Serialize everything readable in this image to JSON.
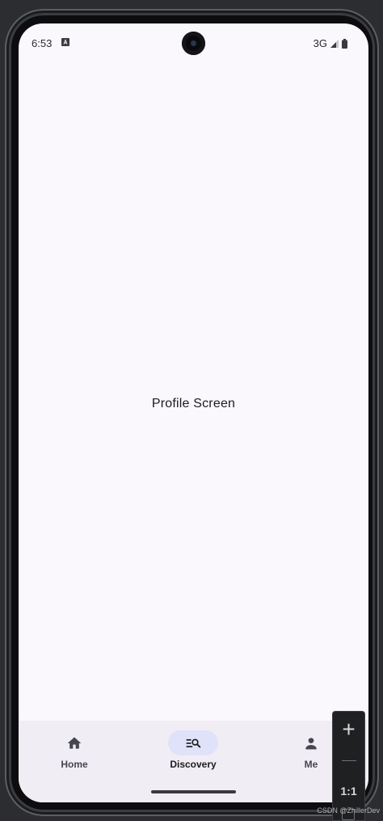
{
  "status_bar": {
    "time": "6:53",
    "network": "3G"
  },
  "main": {
    "title": "Profile Screen"
  },
  "bottom_nav": {
    "items": [
      {
        "label": "Home",
        "icon": "home-icon",
        "active": false
      },
      {
        "label": "Discovery",
        "icon": "discovery-search-icon",
        "active": true
      },
      {
        "label": "Me",
        "icon": "person-icon",
        "active": false
      }
    ],
    "active_pill_color": "#e0e2f9",
    "background_color": "#f1edf4"
  },
  "emulator_zoom": {
    "plus_label": "+",
    "reset_label": "1:1"
  },
  "watermark": "CSDN @ZhillerDev",
  "colors": {
    "screen_background": "#fbf8fd",
    "text_primary": "#1c1b1f"
  }
}
